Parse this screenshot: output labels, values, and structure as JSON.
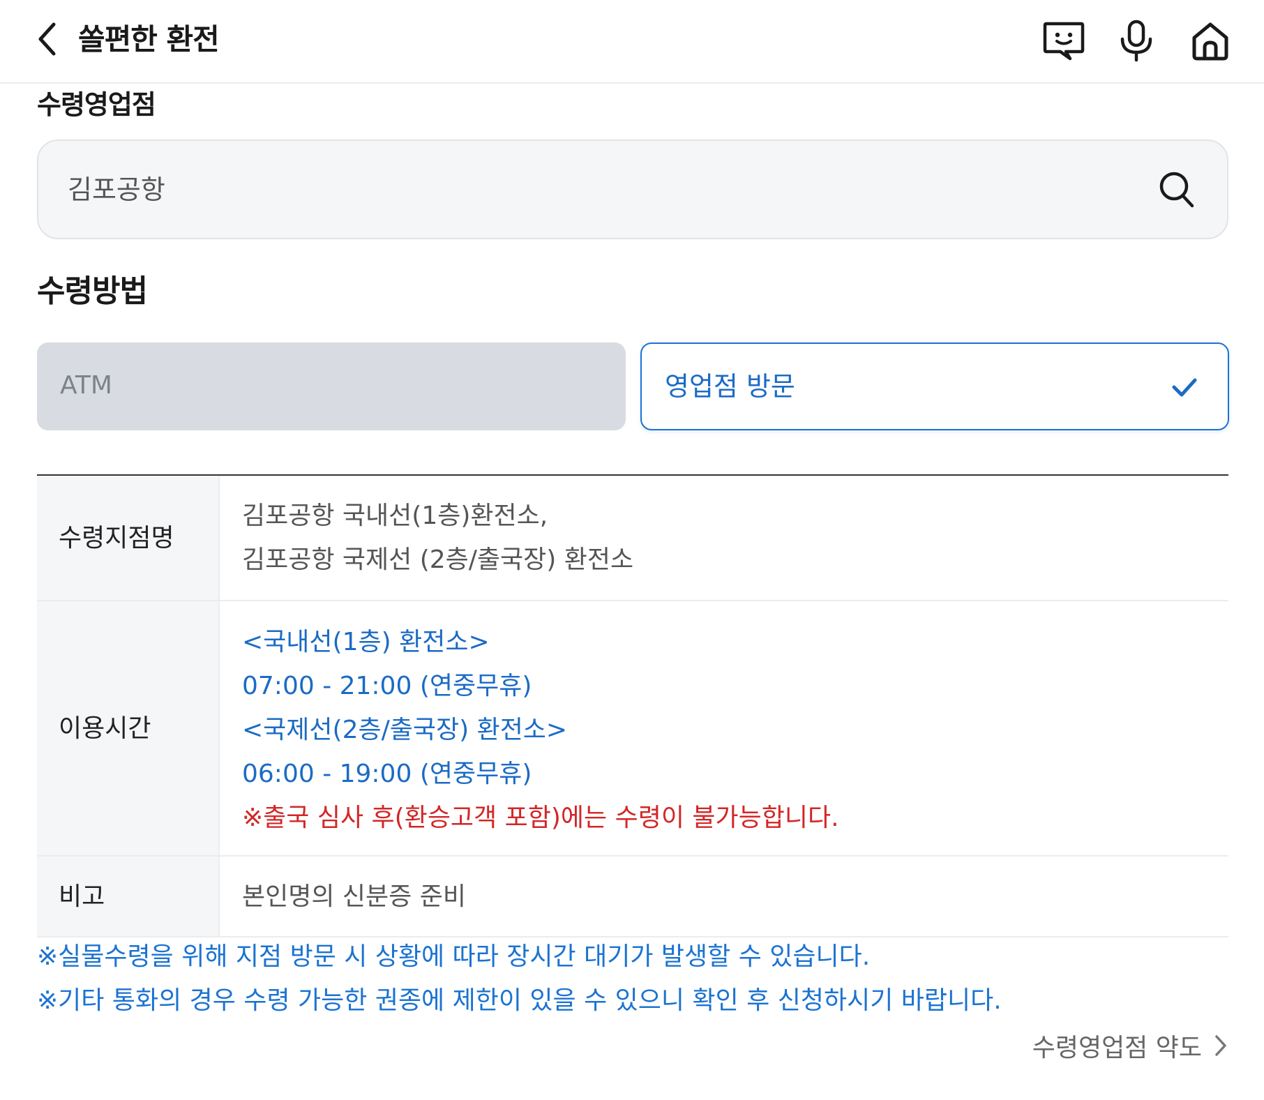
{
  "header": {
    "title": "쏠편한 환전",
    "icons": [
      "back-icon",
      "chatbot-icon",
      "microphone-icon",
      "home-icon"
    ]
  },
  "branch": {
    "label": "수령영업점",
    "search_value": "김포공항",
    "search_icon": "search-icon"
  },
  "method": {
    "label": "수령방법",
    "options": [
      {
        "label": "ATM",
        "selected": false
      },
      {
        "label": "영업점 방문",
        "selected": true
      }
    ]
  },
  "table": {
    "rows": [
      {
        "header": "수령지점명",
        "lines": [
          "김포공항 국내선(1층)환전소,",
          "김포공항 국제선 (2층/출국장) 환전소"
        ]
      },
      {
        "header": "이용시간",
        "lines": [
          "<국내선(1층) 환전소>",
          "07:00 - 21:00 (연중무휴)",
          "<국제선(2층/출국장) 환전소>",
          "06:00 - 19:00 (연중무휴)",
          "※출국 심사 후(환승고객 포함)에는 수령이 불가능합니다."
        ]
      },
      {
        "header": "비고",
        "lines": [
          "본인명의 신분증 준비"
        ]
      }
    ]
  },
  "notes": [
    "※실물수령을 위해 지점 방문 시 상황에 따라 장시간 대기가 발생할 수 있습니다.",
    "※기타 통화의 경우 수령 가능한 권종에 제한이 있을 수 있으니 확인 후 신청하시기 바랍니다."
  ],
  "footer": {
    "link_label": "수령영업점 약도"
  },
  "colors": {
    "accent_blue": "#1b6bc4",
    "warning_red": "#d32626",
    "disabled_gray": "#d8dbe1"
  }
}
